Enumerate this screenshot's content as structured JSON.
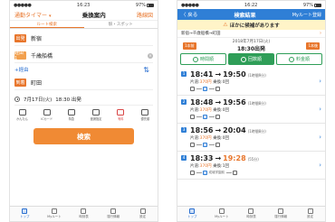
{
  "left": {
    "status": {
      "carrier": "●●●●● ",
      "time": "16:23",
      "battery": "97%"
    },
    "nav": {
      "left_link": "通勤タイマー",
      "title": "乗換案内",
      "right_link": "路線図"
    },
    "tabs": [
      {
        "label": "ルート検索"
      },
      {
        "label": "駅・スポット"
      }
    ],
    "departure": {
      "tag": "出発",
      "value": "新宿"
    },
    "via": {
      "tag": "経由1",
      "value": "千歳船橋"
    },
    "add_via": "+経由",
    "arrival": {
      "tag": "到着",
      "value": "町田"
    },
    "datetime": {
      "date": "7月17日(火)",
      "time": "18:30 出発"
    },
    "options": [
      {
        "label": "かんたん"
      },
      {
        "label": "ICカード"
      },
      {
        "label": "特急"
      },
      {
        "label": "座席指定"
      },
      {
        "label": "有料"
      },
      {
        "label": "優先順"
      }
    ],
    "search_button": "検索",
    "tabbar": [
      {
        "label": "トップ"
      },
      {
        "label": "Myルート"
      },
      {
        "label": "時刻表"
      },
      {
        "label": "運行情報"
      },
      {
        "label": "設定"
      }
    ]
  },
  "right": {
    "status": {
      "carrier": "●●●●● ",
      "time": "16:22",
      "battery": "97%"
    },
    "nav": {
      "back": "〈 戻る",
      "title": "検索結果",
      "save": "Myルート登録"
    },
    "notice": "ほかに候補があります",
    "route": {
      "text": "新宿→千歳船橋→町田"
    },
    "date": {
      "prev": "1本前",
      "line1": "2018年7月17日(火)",
      "line2": "18:30出発",
      "next": "1本後"
    },
    "sort_tabs": [
      {
        "label": "時間順"
      },
      {
        "label": "回数順"
      },
      {
        "label": "料金順"
      }
    ],
    "results": [
      {
        "no": "1",
        "dep": "18:41",
        "arr": "19:50",
        "dur": "(1時間9分)",
        "fare_label": "片道:",
        "fare": "370円",
        "transfer": "乗換:0回",
        "leg_text": ""
      },
      {
        "no": "2",
        "dep": "18:48",
        "arr": "19:56",
        "dur": "(1時間8分)",
        "fare_label": "片道:",
        "fare": "370円",
        "transfer": "乗換:0回",
        "leg_text": ""
      },
      {
        "no": "3",
        "dep": "18:56",
        "arr": "20:04",
        "dur": "(1時間8分)",
        "fare_label": "片道:",
        "fare": "370円",
        "transfer": "乗換:0回",
        "leg_text": ""
      },
      {
        "no": "4",
        "dep": "18:33",
        "arr": "19:28",
        "dur": "(55分)",
        "fare_label": "片道:",
        "fare": "370円",
        "transfer": "乗換:1回",
        "leg_text": "成城学園前"
      }
    ],
    "tabbar": [
      {
        "label": "トップ"
      },
      {
        "label": "Myルート"
      },
      {
        "label": "時刻表"
      },
      {
        "label": "運行情報"
      },
      {
        "label": "設定"
      }
    ]
  }
}
